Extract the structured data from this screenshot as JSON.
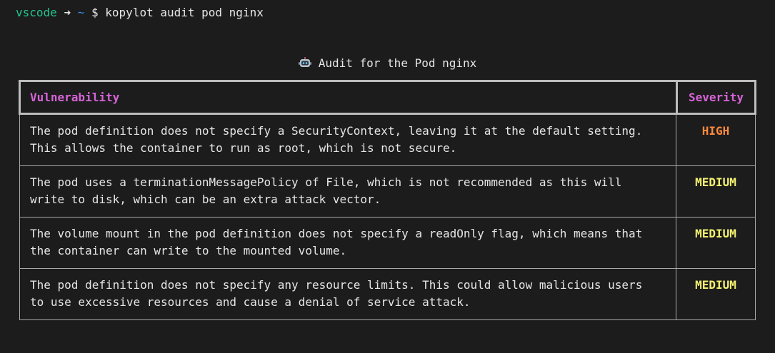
{
  "prompt": {
    "user": "vscode",
    "arrow": "➜",
    "cwd": "~",
    "dollar": "$",
    "command": "kopylot audit pod nginx"
  },
  "audit": {
    "title": "Audit for the Pod nginx",
    "title_icon": "robot-icon",
    "columns": {
      "vulnerability": "Vulnerability",
      "severity": "Severity"
    },
    "rows": [
      {
        "vulnerability": "The pod definition does not specify a SecurityContext, leaving it at the default setting.\nThis allows the container to run as root, which is not secure.",
        "severity": "HIGH"
      },
      {
        "vulnerability": "The pod uses a terminationMessagePolicy of File, which is not recommended as this will\nwrite to disk, which can be an extra attack vector.",
        "severity": "MEDIUM"
      },
      {
        "vulnerability": "The volume mount in the pod definition does not specify a readOnly flag, which means that\nthe container can write to the mounted volume.",
        "severity": "MEDIUM"
      },
      {
        "vulnerability": "The pod definition does not specify any resource limits. This could allow malicious users\nto use excessive resources and cause a denial of service attack.",
        "severity": "MEDIUM"
      }
    ]
  },
  "colors": {
    "background": "#1c1c1c",
    "prompt_user": "#23c48e",
    "prompt_cwd": "#3b8eea",
    "header_text": "#d764d8",
    "severity_high": "#ff8a3d",
    "severity_medium": "#f5f271"
  }
}
